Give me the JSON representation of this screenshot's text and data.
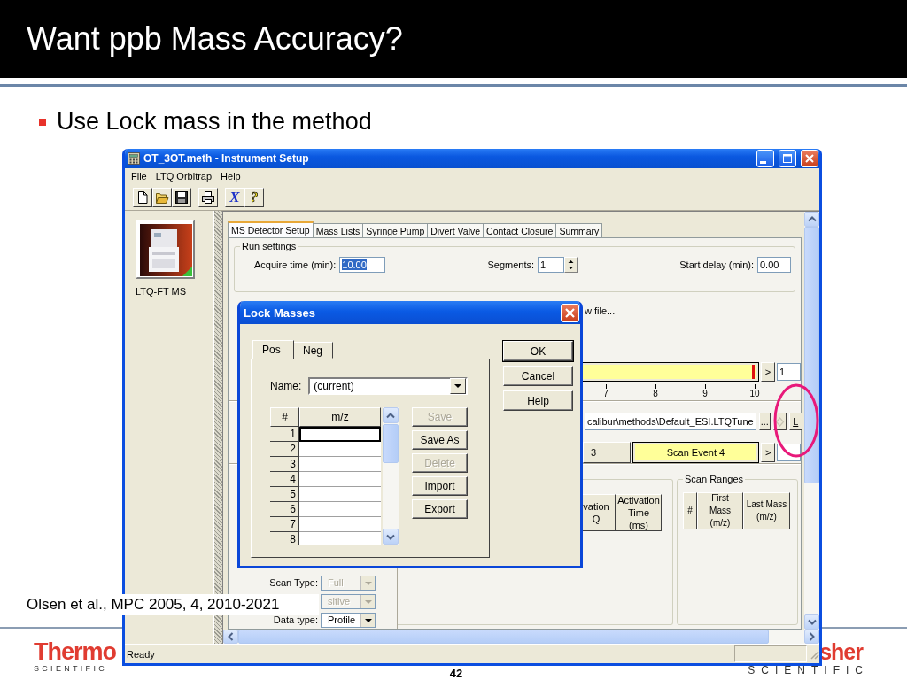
{
  "slide": {
    "title": "Want ppb Mass Accuracy?",
    "bullets": [
      "Use Lock mass in the method"
    ],
    "citation": "Olsen et al., MPC 2005, 4, 2010-2021",
    "page_number": "42",
    "logos": [
      {
        "brand": "Thermo",
        "tagline": "SCIENTIFIC"
      },
      {
        "brand": "sher",
        "tagline": "SCIENTIFIC"
      }
    ]
  },
  "window": {
    "title": "OT_3OT.meth - Instrument Setup",
    "menu": [
      "File",
      "LTQ Orbitrap",
      "Help"
    ],
    "toolbar": [
      {
        "kind": "new"
      },
      {
        "kind": "open"
      },
      {
        "kind": "save"
      },
      {
        "kind": "print"
      },
      {
        "kind": "glyph",
        "text": "X",
        "color": "#1a2fc8"
      },
      {
        "kind": "glyph",
        "text": "?",
        "color": "#f0dc20"
      }
    ],
    "instrument": {
      "label": "LTQ-FT MS"
    },
    "tabs": [
      {
        "label": "MS Detector Setup",
        "selected": true
      },
      {
        "label": "Mass Lists",
        "selected": false
      },
      {
        "label": "Syringe Pump",
        "selected": false
      },
      {
        "label": "Divert Valve",
        "selected": false
      },
      {
        "label": "Contact Closure",
        "selected": false
      },
      {
        "label": "Summary",
        "selected": false
      }
    ],
    "run_settings": {
      "title": "Run settings",
      "fields": [
        {
          "label": "Acquire time (min):",
          "value": "10.00",
          "kind": "text",
          "text_selected": true
        },
        {
          "label": "Segments:",
          "value": "1",
          "kind": "spinner",
          "text_selected": false
        },
        {
          "label": "Start delay (min):",
          "value": "0.00",
          "kind": "text",
          "text_selected": false
        }
      ]
    },
    "file_note": "w file...",
    "segment_bar": {
      "next": ">",
      "count": "1",
      "ticks": [
        "7",
        "8",
        "9",
        "10"
      ]
    },
    "tune_file": {
      "path": "calibur\\methods\\Default_ESI.LTQTune",
      "buttons": [
        {
          "kind": "browse",
          "label": "...",
          "disabled": false,
          "highlighted": false
        },
        {
          "kind": "diamond",
          "disabled": true,
          "highlighted": false
        },
        {
          "kind": "lock",
          "label": "L",
          "disabled": false,
          "highlighted": true
        }
      ]
    },
    "scan_events": {
      "items": [
        {
          "label": "3",
          "selected": false
        },
        {
          "label": "Scan Event 4",
          "selected": true
        }
      ],
      "next": ">"
    },
    "scan_settings": [
      {
        "label": "Scan Type:",
        "value": "Full",
        "disabled": true
      },
      {
        "value": "sitive",
        "disabled": true
      },
      {
        "label": "Data type:",
        "value": "Profile",
        "disabled": false
      }
    ],
    "activation_columns": [
      "vation Q",
      "Activation Time (ms)"
    ],
    "scan_ranges": {
      "title": "Scan Ranges",
      "columns": [
        "#",
        "First Mass (m/z)",
        "Last Mass (m/z)"
      ]
    },
    "status_bar": "Ready"
  },
  "dialog": {
    "title": "Lock Masses",
    "tabs": [
      {
        "label": "Pos",
        "selected": true
      },
      {
        "label": "Neg",
        "selected": false
      }
    ],
    "name": {
      "label": "Name:",
      "value": "(current)"
    },
    "table": {
      "columns": [
        "#",
        "m/z"
      ],
      "rows": [
        {
          "index": "1",
          "focused": true
        },
        {
          "index": "2",
          "focused": false
        },
        {
          "index": "3",
          "focused": false
        },
        {
          "index": "4",
          "focused": false
        },
        {
          "index": "5",
          "focused": false
        },
        {
          "index": "6",
          "focused": false
        },
        {
          "index": "7",
          "focused": false
        },
        {
          "index": "8",
          "focused": false
        }
      ]
    },
    "actions": [
      {
        "label": "Save",
        "disabled": true
      },
      {
        "label": "Save As",
        "disabled": false
      },
      {
        "label": "Delete",
        "disabled": true
      },
      {
        "label": "Import",
        "disabled": false
      },
      {
        "label": "Export",
        "disabled": false
      }
    ],
    "buttons": [
      {
        "label": "OK",
        "default": true
      },
      {
        "label": "Cancel",
        "default": false
      },
      {
        "label": "Help",
        "default": false
      }
    ]
  }
}
